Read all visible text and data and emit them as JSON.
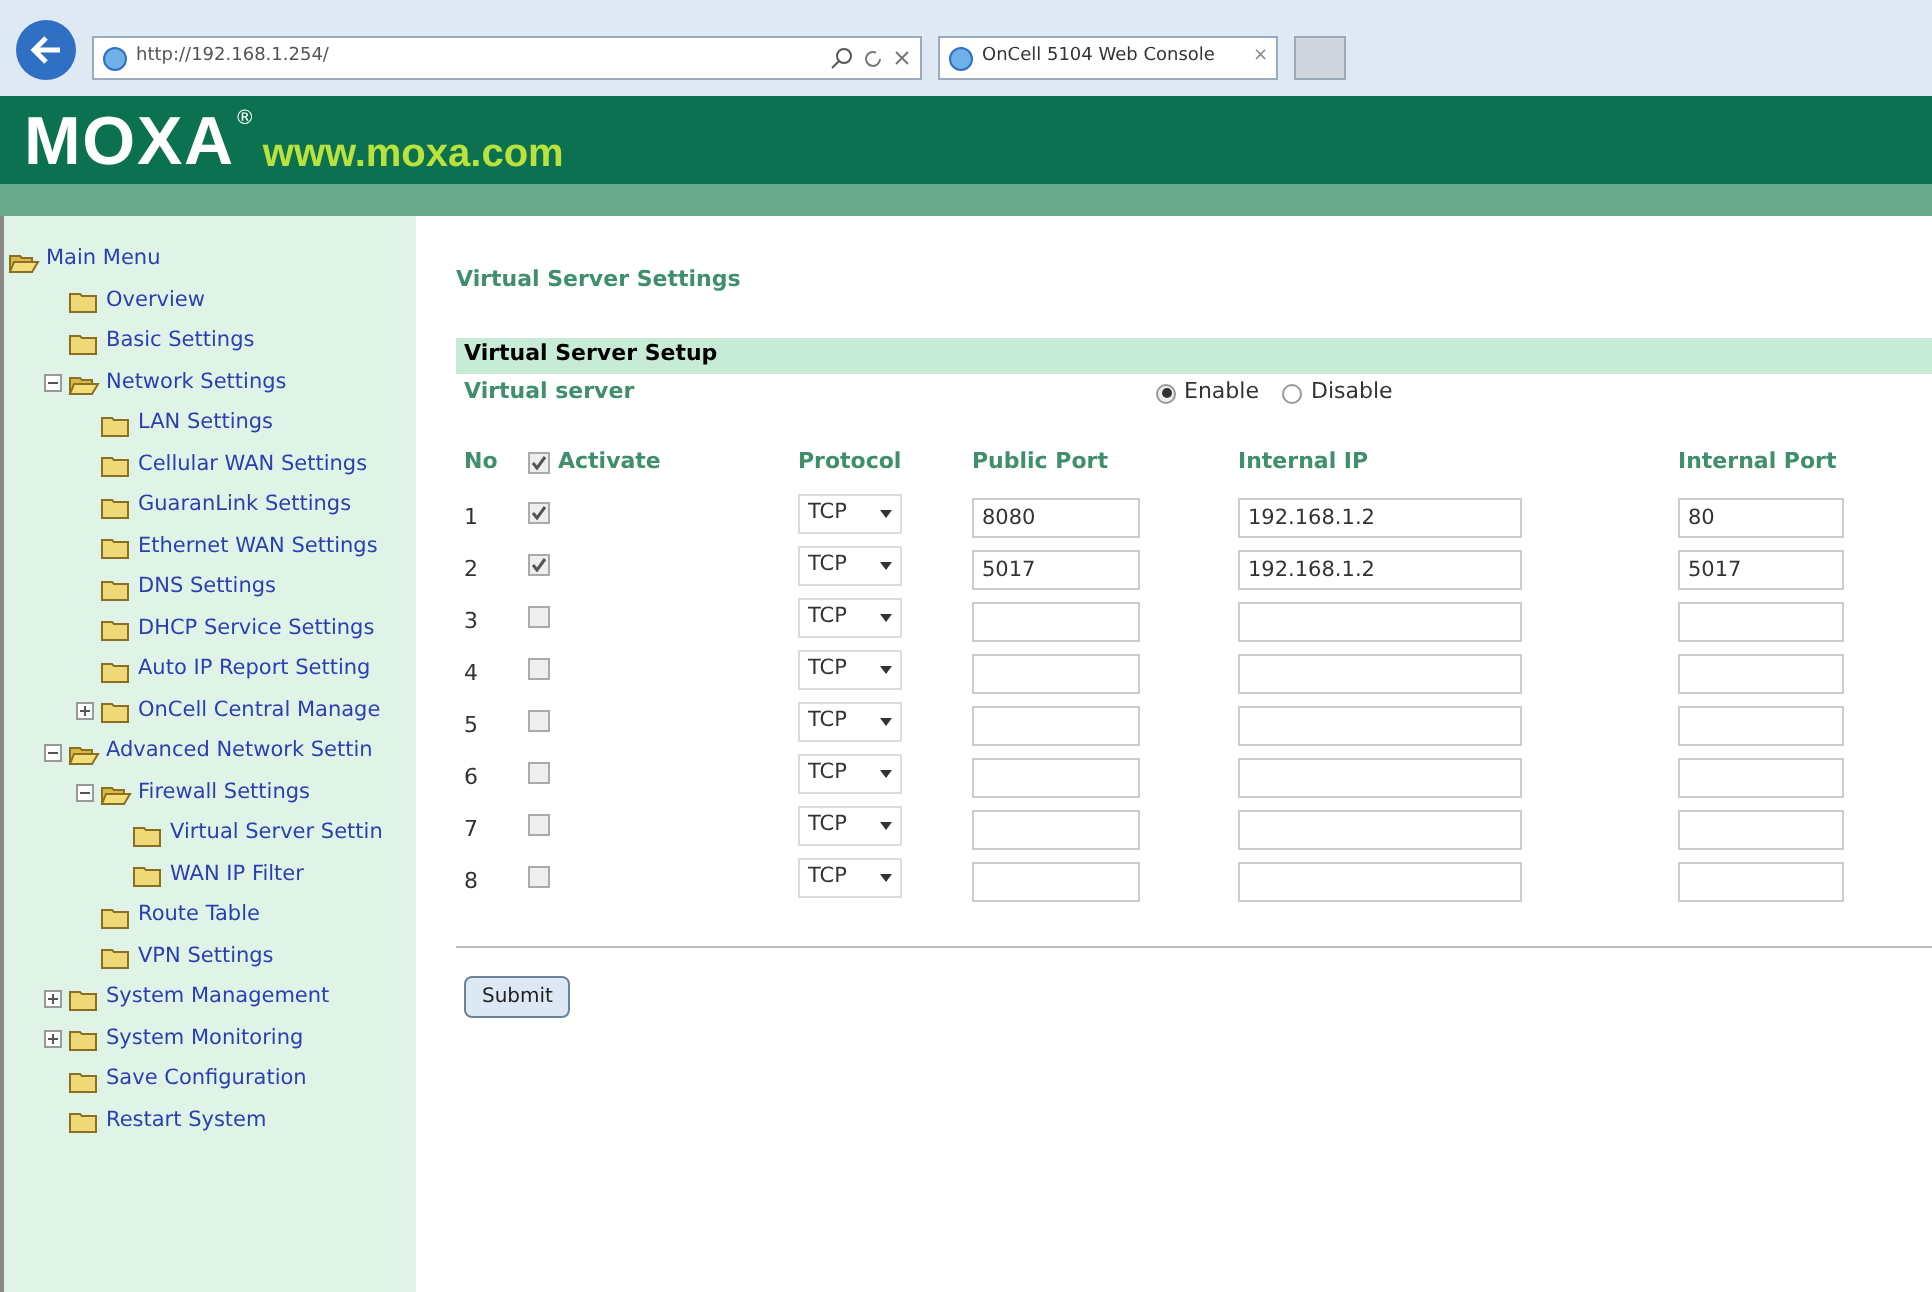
{
  "browser": {
    "address": "http://192.168.1.254/",
    "tab": {
      "title": "OnCell 5104 Web Console",
      "close": "×"
    }
  },
  "header": {
    "logo": "MOXA",
    "registered": "®",
    "site": "www.moxa.com"
  },
  "sidebar": {
    "root": "Main Menu",
    "items": [
      {
        "label": "Overview"
      },
      {
        "label": "Basic Settings"
      },
      {
        "label": "Network Settings",
        "expanded": true,
        "children": [
          {
            "label": "LAN Settings"
          },
          {
            "label": "Cellular WAN Settings"
          },
          {
            "label": "GuaranLink Settings"
          },
          {
            "label": "Ethernet WAN Settings"
          },
          {
            "label": "DNS Settings"
          },
          {
            "label": "DHCP Service Settings"
          },
          {
            "label": "Auto IP Report Setting"
          },
          {
            "label": "OnCell Central Manage",
            "expanded": false
          }
        ]
      },
      {
        "label": "Advanced Network Settin",
        "expanded": true,
        "children": [
          {
            "label": "Firewall Settings",
            "expanded": true,
            "children": [
              {
                "label": "Virtual Server Settin"
              },
              {
                "label": "WAN IP Filter"
              }
            ]
          },
          {
            "label": "Route Table"
          },
          {
            "label": "VPN Settings"
          }
        ]
      },
      {
        "label": "System Management",
        "expanded": false
      },
      {
        "label": "System Monitoring",
        "expanded": false
      },
      {
        "label": "Save Configuration"
      },
      {
        "label": "Restart System"
      }
    ]
  },
  "page_title": "Virtual Server Settings",
  "section_title": "Virtual Server Setup",
  "virtual_server": {
    "label": "Virtual server",
    "options": [
      {
        "label": "Enable",
        "selected": true
      },
      {
        "label": "Disable",
        "selected": false
      }
    ]
  },
  "table": {
    "columns": [
      "No",
      "Activate",
      "Protocol",
      "Public Port",
      "Internal IP",
      "Internal Port"
    ],
    "activate_all": true,
    "rows": [
      {
        "no": "1",
        "activated": true,
        "protocol": "TCP",
        "public_port": "8080",
        "internal_ip": "192.168.1.2",
        "internal_port": "80"
      },
      {
        "no": "2",
        "activated": true,
        "protocol": "TCP",
        "public_port": "5017",
        "internal_ip": "192.168.1.2",
        "internal_port": "5017"
      },
      {
        "no": "3",
        "activated": false,
        "protocol": "TCP"
      },
      {
        "no": "4",
        "activated": false,
        "protocol": "TCP"
      },
      {
        "no": "5",
        "activated": false,
        "protocol": "TCP"
      },
      {
        "no": "6",
        "activated": false,
        "protocol": "TCP"
      },
      {
        "no": "7",
        "activated": false,
        "protocol": "TCP"
      },
      {
        "no": "8",
        "activated": false,
        "protocol": "TCP"
      }
    ]
  },
  "submit": "Submit"
}
